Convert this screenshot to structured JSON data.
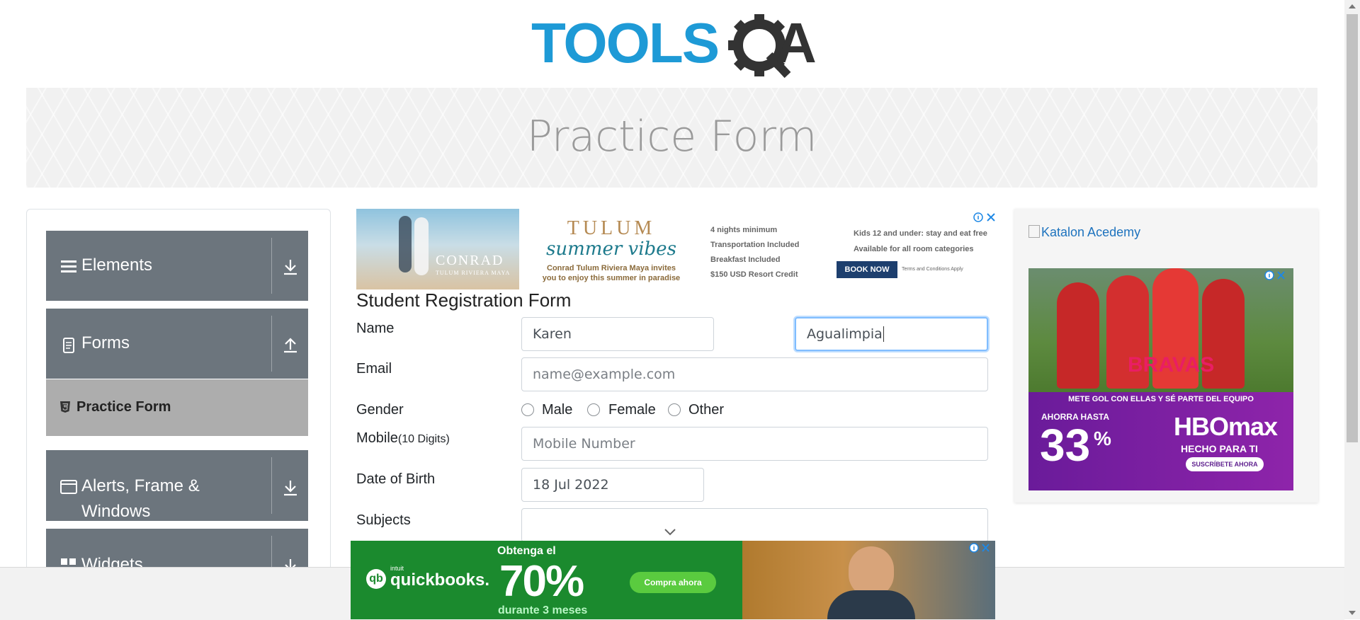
{
  "header": {
    "logo_text": "TOOLSQA",
    "page_title": "Practice Form"
  },
  "sidebar": {
    "groups": [
      {
        "label": "Elements",
        "icon": "menu-icon",
        "arrow": "download-arrow-icon"
      },
      {
        "label": "Forms",
        "icon": "document-icon",
        "arrow": "upload-arrow-icon"
      },
      {
        "label": "Alerts, Frame &",
        "label2": "Windows",
        "icon": "window-icon",
        "arrow": "download-arrow-icon"
      },
      {
        "label": "Widgets",
        "icon": "widgets-icon",
        "arrow": "download-arrow-icon"
      }
    ],
    "active_item": {
      "label": "Practice Form",
      "icon": "html5-icon"
    }
  },
  "ads": {
    "top": {
      "brand": "CONRAD",
      "brand_sub": "TULUM RIVIERA MAYA",
      "headline": "TULUM",
      "script_line": "summer vibes",
      "tagline1": "Conrad Tulum Riviera Maya invites",
      "tagline2": "you to enjoy this summer in paradise",
      "features_left": [
        "4 nights minimum",
        "Transportation Included",
        "Breakfast Included",
        "$150 USD Resort Credit"
      ],
      "features_right": [
        "Kids 12 and under: stay and eat free",
        "Available for all room categories"
      ],
      "cta": "BOOK NOW",
      "terms": "Terms and Conditions Apply"
    },
    "right": {
      "link_text": "Katalon Acedemy",
      "promo_line": "METE GOL CON ELLAS Y SÉ PARTE DEL EQUIPO",
      "discount_prefix": "AHORRA HASTA",
      "discount_value": "33",
      "discount_unit": "%",
      "brand": "HBOmax",
      "brand_tagline": "HECHO PARA TI",
      "cta": "SUSCRÍBETE AHORA",
      "jersey_text": "BRAVAS"
    },
    "bottom": {
      "brand_small": "intuit",
      "brand": "quickbooks.",
      "offer_line1": "Obtenga el",
      "offer_value": "70%",
      "offer_line3": "durante 3 meses",
      "cta": "Compra ahora"
    }
  },
  "form": {
    "title": "Student Registration Form",
    "name_label": "Name",
    "first_name_value": "Karen",
    "last_name_value": "Agualimpia",
    "email_label": "Email",
    "email_placeholder": "name@example.com",
    "gender_label": "Gender",
    "gender_options": [
      "Male",
      "Female",
      "Other"
    ],
    "mobile_label": "Mobile",
    "mobile_hint": "(10 Digits)",
    "mobile_placeholder": "Mobile Number",
    "dob_label": "Date of Birth",
    "dob_value": "18 Jul 2022",
    "subjects_label": "Subjects",
    "subjects_value": ""
  },
  "colors": {
    "sidebar_group": "#6c757d",
    "active_item_bg": "#adadad",
    "focus_border": "#80bdff",
    "logo_blue": "#1e9ad6",
    "logo_dark": "#333333"
  }
}
